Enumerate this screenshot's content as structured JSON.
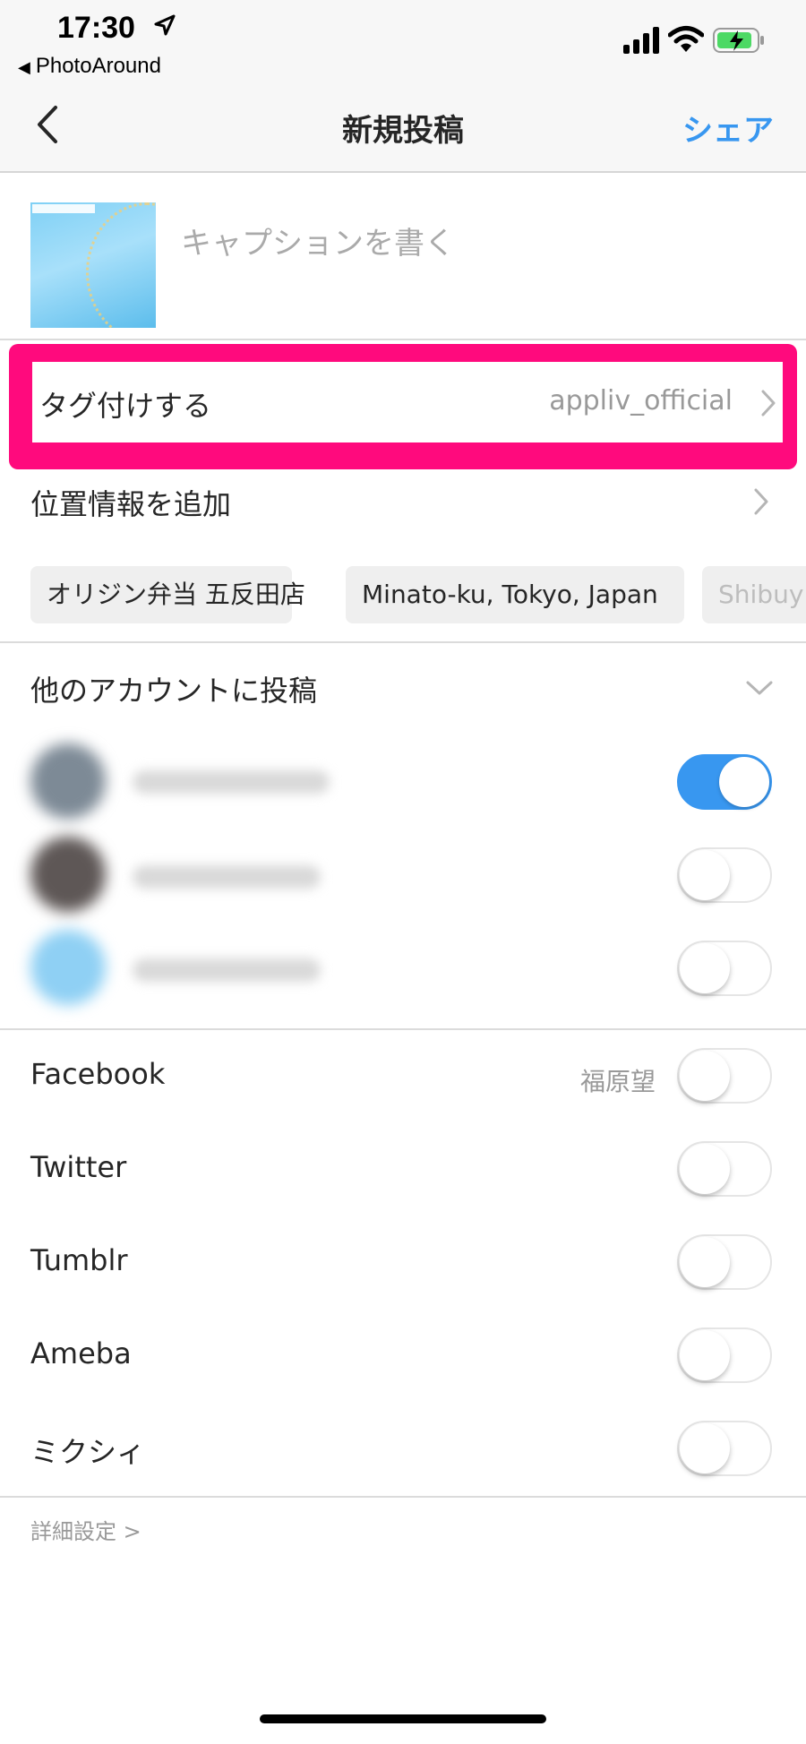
{
  "status_bar": {
    "time": "17:30",
    "back_app": "PhotoAround",
    "back_glyph": "◀"
  },
  "nav": {
    "title": "新規投稿",
    "share_label": "シェア",
    "back_icon": "chevron-left-icon"
  },
  "caption": {
    "placeholder": "キャプションを書く"
  },
  "tag_people": {
    "label": "タグ付けする",
    "value": "appliv_official",
    "highlight_color": "#ff0a7d"
  },
  "location": {
    "label": "位置情報を追加",
    "suggestions": [
      "オリジン弁当 五反田店",
      "Minato-ku, Tokyo, Japan",
      "Shibuy"
    ]
  },
  "other_accounts": {
    "label": "他のアカウントに投稿",
    "accounts": [
      {
        "enabled": true
      },
      {
        "enabled": false
      },
      {
        "enabled": false
      }
    ]
  },
  "share_targets": [
    {
      "label": "Facebook",
      "user": "福原望",
      "enabled": false
    },
    {
      "label": "Twitter",
      "enabled": false
    },
    {
      "label": "Tumblr",
      "enabled": false
    },
    {
      "label": "Ameba",
      "enabled": false
    },
    {
      "label": "ミクシィ",
      "enabled": false
    }
  ],
  "advanced_settings": {
    "label": "詳細設定 >"
  },
  "colors": {
    "accent": "#3897f0",
    "toggle_on": "#3897f0"
  }
}
